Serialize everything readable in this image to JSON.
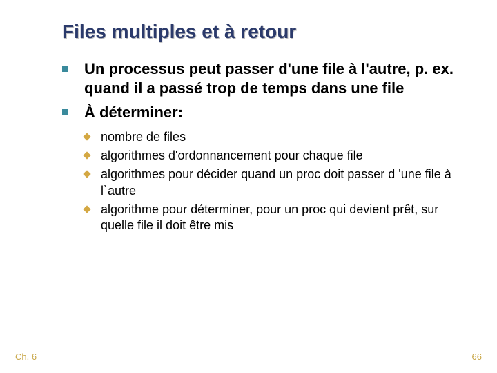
{
  "title": "Files multiples et à retour",
  "bullets": [
    {
      "text": "Un processus peut passer d'une file à l'autre, p. ex. quand il a passé trop de temps dans une file"
    },
    {
      "text": "À déterminer:"
    }
  ],
  "subbullets": [
    {
      "text": "nombre de files"
    },
    {
      "text": "algorithmes d'ordonnancement pour chaque file"
    },
    {
      "text": "algorithmes pour décider quand un proc doit passer d 'une file à l`autre"
    },
    {
      "text": "algorithme pour déterminer, pour un proc qui devient prêt, sur quelle file il doit être mis"
    }
  ],
  "footer": {
    "left": "Ch. 6",
    "right": "66"
  }
}
